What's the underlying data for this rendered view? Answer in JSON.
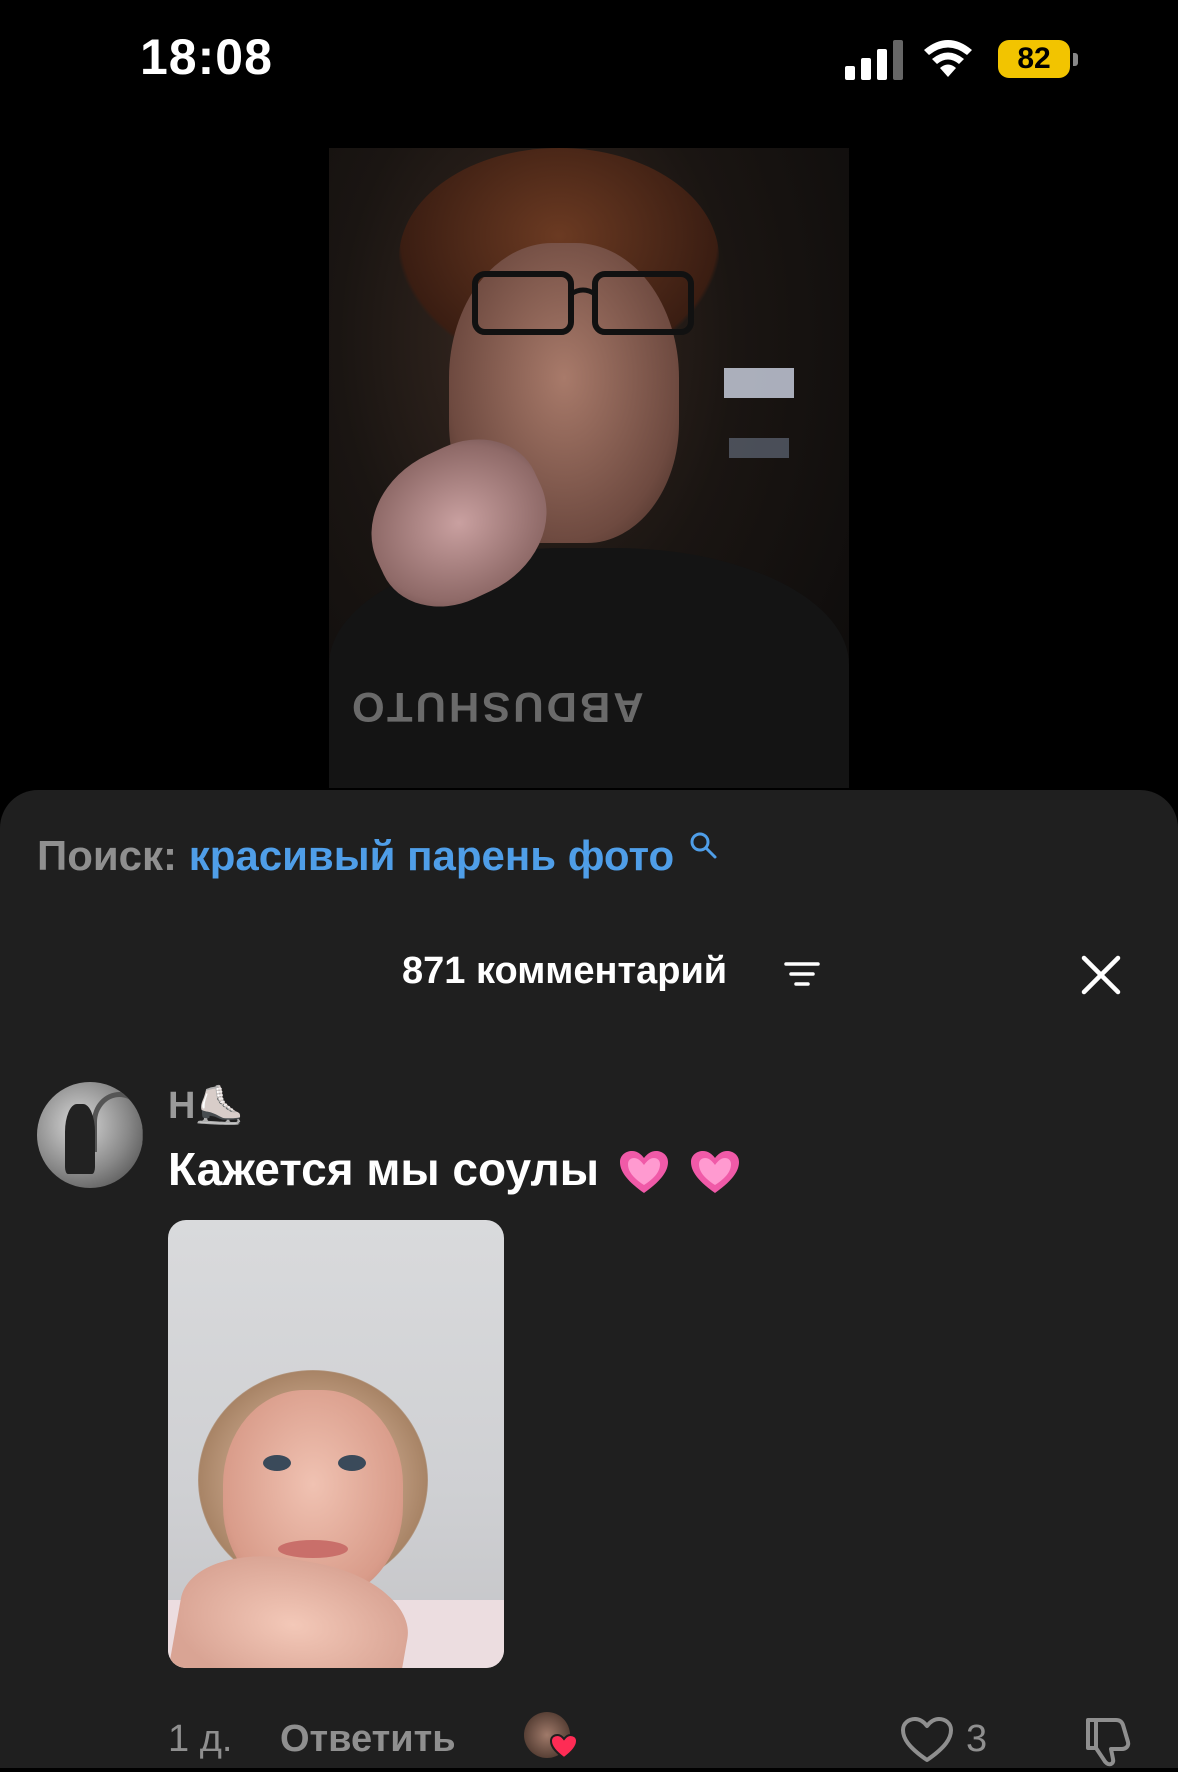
{
  "status_bar": {
    "time": "18:08",
    "battery_level": "82",
    "battery_color": "#f2c400",
    "icons": [
      "signal-icon",
      "wifi-icon",
      "battery-icon"
    ]
  },
  "video": {
    "description_icon": "video-frame"
  },
  "search": {
    "prefix": "Поиск:",
    "query": "красивый парень фото",
    "query_color": "#4f9ee8",
    "icon": "search-icon"
  },
  "comments_header": {
    "count_label": "871 комментарий",
    "filter_icon": "filter-icon",
    "close_icon": "close-icon"
  },
  "comment": {
    "username": "Н⛸️",
    "text": "Кажется мы соулы",
    "emoji_icons": [
      "pink-heart-icon",
      "pink-heart-icon"
    ],
    "time_ago": "1 д.",
    "reply_label": "Ответить",
    "like_count": "3",
    "like_icon": "heart-outline-icon",
    "dislike_icon": "thumbs-down-icon",
    "creator_liked_icon": "creator-like-heart-icon"
  },
  "colors": {
    "sheet_background": "#1f1f1f",
    "muted_text": "#8f8f8f",
    "accent_red": "#fe2c55"
  }
}
